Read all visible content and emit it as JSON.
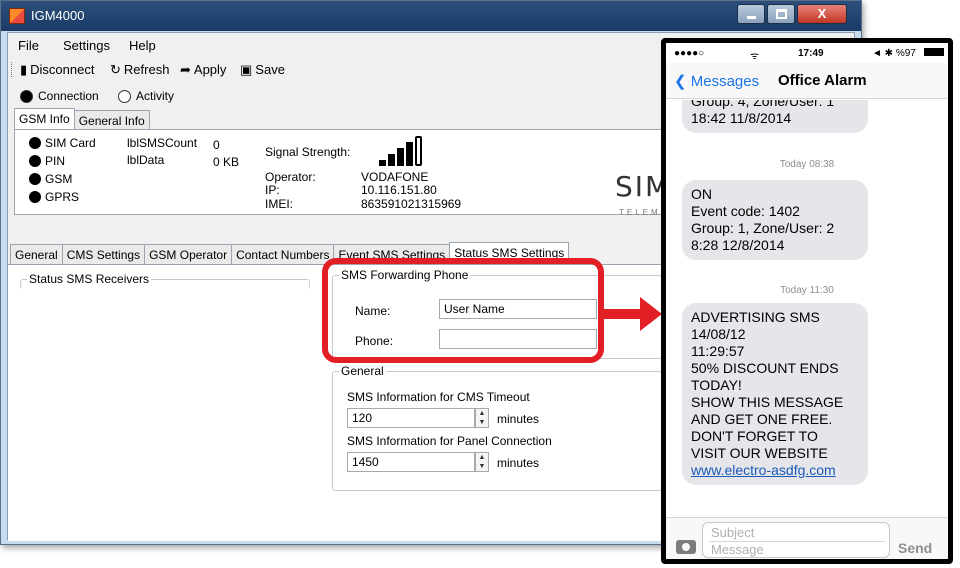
{
  "window": {
    "title": "IGM4000",
    "buttons": {
      "minimize": "",
      "maximize": "",
      "close": "X"
    }
  },
  "menu": [
    "File",
    "Settings",
    "Help"
  ],
  "toolbar": {
    "disconnect": "Disconnect",
    "refresh": "Refresh",
    "apply": "Apply",
    "save": "Save"
  },
  "radios": {
    "connection": "Connection",
    "activity": "Activity"
  },
  "info_tabs": [
    "GSM Info",
    "General Info"
  ],
  "gsm_info": {
    "indicators": [
      "SIM Card",
      "PIN",
      "GSM",
      "GPRS"
    ],
    "sms_count_label": "lblSMSCount",
    "sms_count_value": "0",
    "data_label": "lblData",
    "data_value": "0 KB",
    "signal_label": "Signal Strength:",
    "operator_label": "Operator:",
    "operator_value": "VODAFONE",
    "ip_label": "IP:",
    "ip_value": "10.116.151.80",
    "imei_label": "IMEI:",
    "imei_value": "863591021315969",
    "signal_bars_filled": 4,
    "signal_bars_total": 5
  },
  "logo": {
    "text": "SIM",
    "sub": "TELEME"
  },
  "settings_tabs": [
    "General",
    "CMS Settings",
    "GSM Operator",
    "Contact Numbers",
    "Event SMS Settings",
    "Status SMS Settings"
  ],
  "status_sms": {
    "receivers_title": "Status SMS Receivers",
    "forwarding_title": "SMS Forwarding Phone",
    "name_label": "Name:",
    "name_value": "User Name",
    "phone_label": "Phone:",
    "phone_value": "",
    "general_title": "General",
    "cms_timeout_label": "SMS Information for CMS Timeout",
    "cms_timeout_value": "120",
    "panel_conn_label": "SMS Information for Panel Connection",
    "panel_conn_value": "1450",
    "minutes_unit": "minutes"
  },
  "phone": {
    "status": {
      "carrier": "●●●●○",
      "wifi": "WiFi",
      "time": "17:49",
      "battery": "◄ ✱ %97"
    },
    "back_label": "Messages",
    "contact": "Office Alarm",
    "bubble1_lines": [
      "Group: 4, Zone/User: 1",
      "18:42 11/8/2014"
    ],
    "timestamp1": "Today 08:38",
    "bubble2_lines": [
      "ON",
      "Event code: 1402",
      "Group: 1, Zone/User: 2",
      "8:28 12/8/2014"
    ],
    "timestamp2": "Today 11:30",
    "bubble3_lines": [
      "ADVERTISING SMS",
      "14/08/12",
      "11:29:57",
      "50% DISCOUNT ENDS",
      "TODAY!",
      "SHOW THIS MESSAGE",
      "AND GET ONE FREE.",
      "DON'T FORGET TO",
      "VISIT OUR WEBSITE"
    ],
    "bubble3_link": "www.electro-asdfg.com",
    "subject_placeholder": "Subject",
    "message_placeholder": "Message",
    "send_label": "Send"
  },
  "colors": {
    "callout": "#e21f25",
    "ios_blue": "#1a73e8",
    "bubble": "#e5e5ea",
    "titlebar": "#1b3b66"
  }
}
